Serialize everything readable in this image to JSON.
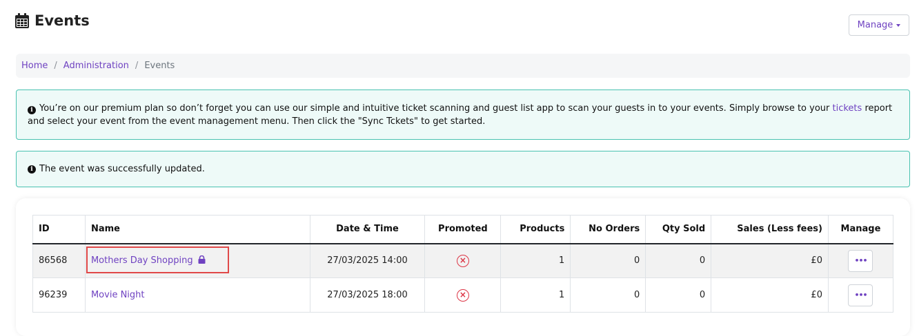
{
  "page": {
    "title": "Events",
    "manage_label": "Manage"
  },
  "breadcrumb": {
    "home": "Home",
    "admin": "Administration",
    "current": "Events",
    "separator": "/"
  },
  "alerts": {
    "premium_before": "You’re on our premium plan so don’t forget you can use our simple and intuitive ticket scanning and guest list app to scan your guests in to your events. Simply browse to your ",
    "premium_link": "tickets",
    "premium_after": " report and select your event from the event management menu. Then click the \"Sync Tckets\" to get started.",
    "success": "The event was successfully updated."
  },
  "table": {
    "headers": {
      "id": "ID",
      "name": "Name",
      "datetime": "Date & Time",
      "promoted": "Promoted",
      "products": "Products",
      "orders": "No Orders",
      "qty": "Qty Sold",
      "sales": "Sales (Less fees)",
      "manage": "Manage"
    },
    "rows": [
      {
        "id": "86568",
        "name": "Mothers Day Shopping",
        "locked": true,
        "datetime": "27/03/2025 14:00",
        "promoted": "no",
        "products": "1",
        "orders": "0",
        "qty": "0",
        "sales": "£0"
      },
      {
        "id": "96239",
        "name": "Movie Night",
        "locked": false,
        "datetime": "27/03/2025 18:00",
        "promoted": "no",
        "products": "1",
        "orders": "0",
        "qty": "0",
        "sales": "£0"
      }
    ]
  },
  "icons": {
    "title": "calendar-icon",
    "info": "info-icon",
    "lock": "lock-icon",
    "not_promoted": "x-circle-icon",
    "row_menu": "ellipsis-icon"
  },
  "colors": {
    "accent": "#6f42c1",
    "alert_border": "#48c1b0",
    "alert_bg": "#eefaf8",
    "danger": "#dc3545",
    "highlight": "#e04848"
  }
}
